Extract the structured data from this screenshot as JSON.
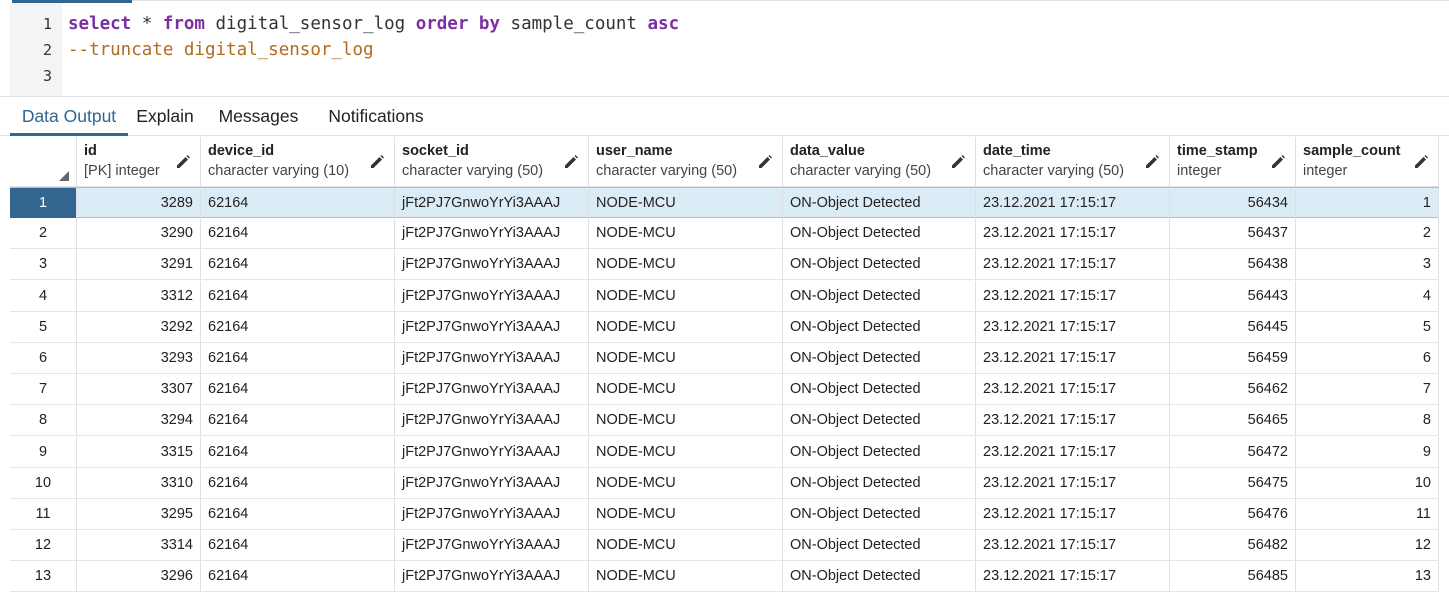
{
  "editor": {
    "lines": [
      {
        "no": "1",
        "tokens": [
          {
            "t": "select",
            "k": "kw"
          },
          {
            "t": " * ",
            "k": "plain"
          },
          {
            "t": "from",
            "k": "kw"
          },
          {
            "t": " digital_sensor_log ",
            "k": "plain"
          },
          {
            "t": "order by",
            "k": "kw"
          },
          {
            "t": " sample_count ",
            "k": "plain"
          },
          {
            "t": "asc",
            "k": "kw"
          }
        ]
      },
      {
        "no": "2",
        "tokens": [
          {
            "t": "--truncate digital_sensor_log",
            "k": "comment"
          }
        ]
      },
      {
        "no": "3",
        "tokens": []
      }
    ]
  },
  "tabs": [
    {
      "label": "Data Output",
      "active": true
    },
    {
      "label": "Explain",
      "active": false
    },
    {
      "label": "Messages",
      "active": false
    },
    {
      "label": "Notifications",
      "active": false
    }
  ],
  "columns": [
    {
      "name": "id",
      "type": "[PK] integer"
    },
    {
      "name": "device_id",
      "type": "character varying (10)"
    },
    {
      "name": "socket_id",
      "type": "character varying (50)"
    },
    {
      "name": "user_name",
      "type": "character varying (50)"
    },
    {
      "name": "data_value",
      "type": "character varying (50)"
    },
    {
      "name": "date_time",
      "type": "character varying (50)"
    },
    {
      "name": "time_stamp",
      "type": "integer"
    },
    {
      "name": "sample_count",
      "type": "integer"
    }
  ],
  "rows": [
    [
      "1",
      "3289",
      "62164",
      "jFt2PJ7GnwoYrYi3AAAJ",
      "NODE-MCU",
      "ON-Object Detected",
      "23.12.2021 17:15:17",
      "56434",
      "1"
    ],
    [
      "2",
      "3290",
      "62164",
      "jFt2PJ7GnwoYrYi3AAAJ",
      "NODE-MCU",
      "ON-Object Detected",
      "23.12.2021 17:15:17",
      "56437",
      "2"
    ],
    [
      "3",
      "3291",
      "62164",
      "jFt2PJ7GnwoYrYi3AAAJ",
      "NODE-MCU",
      "ON-Object Detected",
      "23.12.2021 17:15:17",
      "56438",
      "3"
    ],
    [
      "4",
      "3312",
      "62164",
      "jFt2PJ7GnwoYrYi3AAAJ",
      "NODE-MCU",
      "ON-Object Detected",
      "23.12.2021 17:15:17",
      "56443",
      "4"
    ],
    [
      "5",
      "3292",
      "62164",
      "jFt2PJ7GnwoYrYi3AAAJ",
      "NODE-MCU",
      "ON-Object Detected",
      "23.12.2021 17:15:17",
      "56445",
      "5"
    ],
    [
      "6",
      "3293",
      "62164",
      "jFt2PJ7GnwoYrYi3AAAJ",
      "NODE-MCU",
      "ON-Object Detected",
      "23.12.2021 17:15:17",
      "56459",
      "6"
    ],
    [
      "7",
      "3307",
      "62164",
      "jFt2PJ7GnwoYrYi3AAAJ",
      "NODE-MCU",
      "ON-Object Detected",
      "23.12.2021 17:15:17",
      "56462",
      "7"
    ],
    [
      "8",
      "3294",
      "62164",
      "jFt2PJ7GnwoYrYi3AAAJ",
      "NODE-MCU",
      "ON-Object Detected",
      "23.12.2021 17:15:17",
      "56465",
      "8"
    ],
    [
      "9",
      "3315",
      "62164",
      "jFt2PJ7GnwoYrYi3AAAJ",
      "NODE-MCU",
      "ON-Object Detected",
      "23.12.2021 17:15:17",
      "56472",
      "9"
    ],
    [
      "10",
      "3310",
      "62164",
      "jFt2PJ7GnwoYrYi3AAAJ",
      "NODE-MCU",
      "ON-Object Detected",
      "23.12.2021 17:15:17",
      "56475",
      "10"
    ],
    [
      "11",
      "3295",
      "62164",
      "jFt2PJ7GnwoYrYi3AAAJ",
      "NODE-MCU",
      "ON-Object Detected",
      "23.12.2021 17:15:17",
      "56476",
      "11"
    ],
    [
      "12",
      "3314",
      "62164",
      "jFt2PJ7GnwoYrYi3AAAJ",
      "NODE-MCU",
      "ON-Object Detected",
      "23.12.2021 17:15:17",
      "56482",
      "12"
    ],
    [
      "13",
      "3296",
      "62164",
      "jFt2PJ7GnwoYrYi3AAAJ",
      "NODE-MCU",
      "ON-Object Detected",
      "23.12.2021 17:15:17",
      "56485",
      "13"
    ]
  ],
  "selected_row": 1,
  "colors": {
    "accent": "#326690",
    "keyword": "#7c2ea3",
    "comment": "#b36b1c",
    "selection": "#dcecf7"
  },
  "icons": {
    "edit": "pencil-icon",
    "sort": "sort-corner-icon"
  }
}
